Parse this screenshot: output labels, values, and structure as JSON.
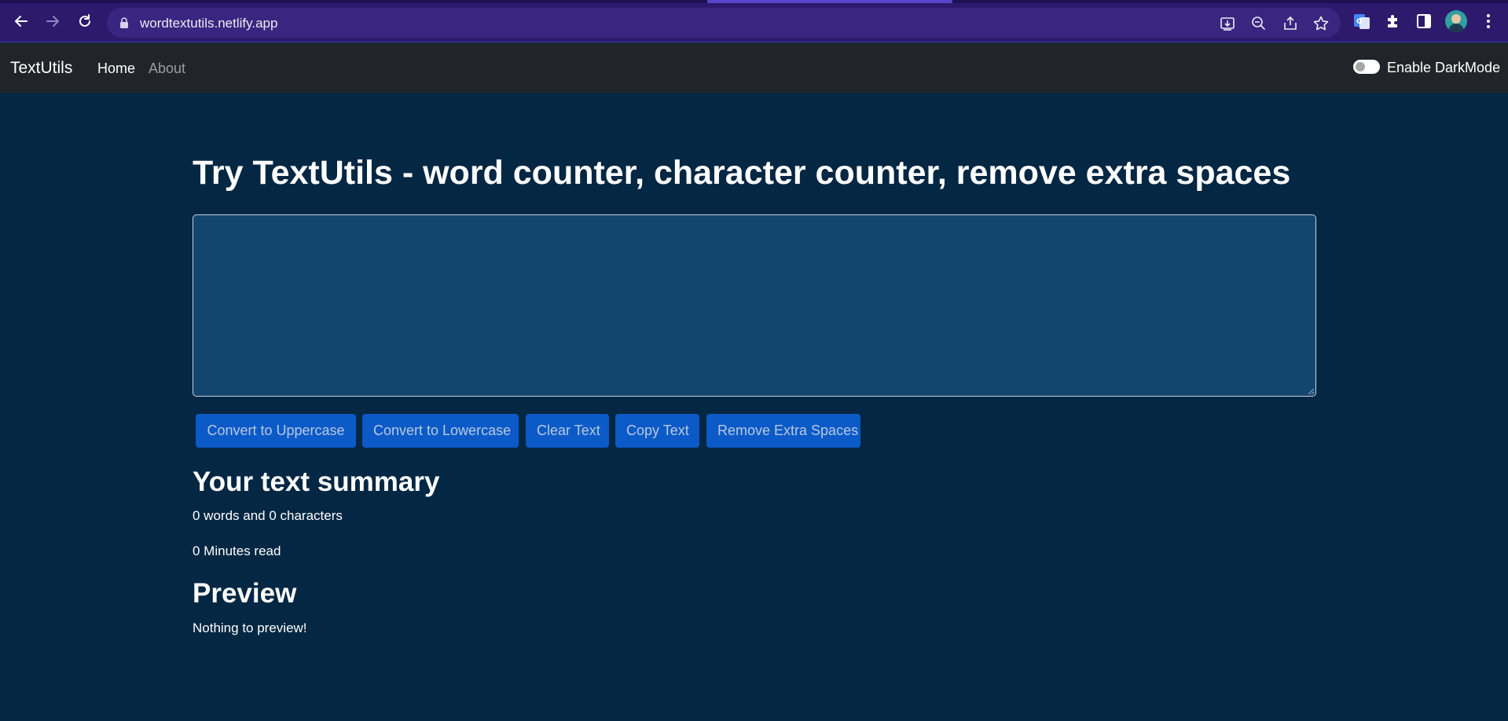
{
  "browser": {
    "url": "wordtextutils.netlify.app",
    "icons": [
      "back-arrow-icon",
      "forward-arrow-icon",
      "reload-icon",
      "lock-icon",
      "install-icon",
      "zoom-out-icon",
      "share-icon",
      "bookmark-star-icon",
      "translate-extension-icon",
      "puzzle-extension-icon",
      "side-panel-icon",
      "profile-avatar",
      "kebab-menu-icon"
    ]
  },
  "navbar": {
    "brand": "TextUtils",
    "links": [
      {
        "label": "Home",
        "active": true
      },
      {
        "label": "About",
        "active": false
      }
    ],
    "darkmode_label": "Enable DarkMode"
  },
  "main": {
    "heading": "Try TextUtils - word counter, character counter, remove extra spaces",
    "textarea_value": "",
    "buttons": [
      {
        "label": "Convert to Uppercase"
      },
      {
        "label": "Convert to Lowercase"
      },
      {
        "label": "Clear Text"
      },
      {
        "label": "Copy Text"
      },
      {
        "label": "Remove Extra Spaces"
      }
    ],
    "summary_title": "Your text summary",
    "word_char_count": "0 words and 0 characters",
    "minutes_read": "0 Minutes read",
    "preview_title": "Preview",
    "preview_text": "Nothing to preview!"
  },
  "colors": {
    "chrome_bg": "#2d1a6d",
    "navbar_bg": "#212529",
    "page_bg": "#042743",
    "textarea_bg": "#13466f",
    "button_bg": "#0b5ac8"
  }
}
